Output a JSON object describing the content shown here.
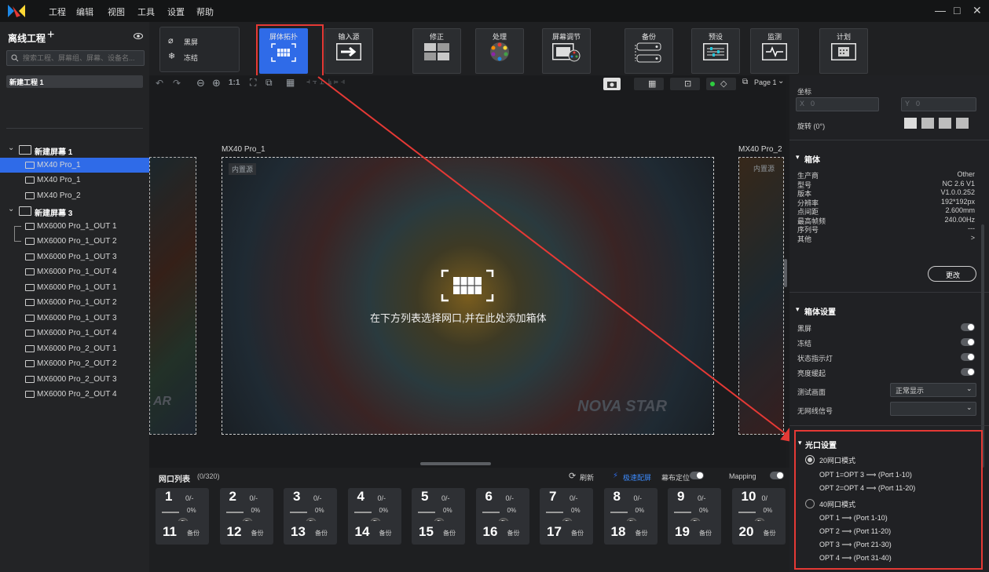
{
  "menu": {
    "items": [
      "工程",
      "编辑",
      "视图",
      "工具",
      "设置",
      "帮助"
    ]
  },
  "window_controls": {
    "minimize": "—",
    "maximize": "□",
    "close": "✕"
  },
  "project": {
    "title": "离线工程",
    "add": "+",
    "search_placeholder": "搜索工程、屏幕组、屏幕、设备名...",
    "current": "新建工程 1"
  },
  "toolbar": {
    "blackout": "黑屏",
    "freeze": "冻结",
    "buttons": [
      {
        "label": "屏体拓扑",
        "icon": "grid-icon"
      },
      {
        "label": "输入源",
        "icon": "arrow-right-icon"
      },
      {
        "label": "修正",
        "icon": "correction-icon"
      },
      {
        "label": "处理",
        "icon": "color-wheel-icon"
      },
      {
        "label": "屏幕调节",
        "icon": "screen-adjust-icon"
      },
      {
        "label": "备份",
        "icon": "backup-icon"
      },
      {
        "label": "预设",
        "icon": "preset-icon"
      },
      {
        "label": "监测",
        "icon": "monitor-icon"
      },
      {
        "label": "计划",
        "icon": "schedule-icon"
      }
    ]
  },
  "tree": {
    "screen1": "新建屏幕 1",
    "screen1_items": [
      "MX40 Pro_1",
      "MX40 Pro_1",
      "MX40 Pro_2"
    ],
    "screen3": "新建屏幕 3",
    "screen3_items": [
      "MX6000 Pro_1_OUT 1",
      "MX6000 Pro_1_OUT 2",
      "MX6000 Pro_1_OUT 3",
      "MX6000 Pro_1_OUT 4",
      "MX6000 Pro_1_OUT 1",
      "MX6000 Pro_1_OUT 2",
      "MX6000 Pro_1_OUT 3",
      "MX6000 Pro_1_OUT 4",
      "MX6000 Pro_2_OUT 1",
      "MX6000 Pro_2_OUT 2",
      "MX6000 Pro_2_OUT 3",
      "MX6000 Pro_2_OUT 4"
    ]
  },
  "canvas": {
    "zoom_label": "1:1",
    "page": "Page 1",
    "screen_left": "MX40 Pro_1",
    "screen_right": "MX40 Pro_2",
    "source_tag": "内置源",
    "hint": "在下方列表选择网口,并在此处添加箱体",
    "watermark": "NOVA STAR"
  },
  "portlist": {
    "title": "网口列表",
    "count": "(0/320)",
    "refresh": "刷新",
    "fast": "极速配屏",
    "locate": "幕布定位",
    "mapping": "Mapping",
    "ports": [
      {
        "n": "1",
        "frac": "0/-",
        "pct": "0%"
      },
      {
        "n": "2",
        "frac": "0/-",
        "pct": "0%"
      },
      {
        "n": "3",
        "frac": "0/-",
        "pct": "0%"
      },
      {
        "n": "4",
        "frac": "0/-",
        "pct": "0%"
      },
      {
        "n": "5",
        "frac": "0/-",
        "pct": "0%"
      },
      {
        "n": "6",
        "frac": "0/-",
        "pct": "0%"
      },
      {
        "n": "7",
        "frac": "0/-",
        "pct": "0%"
      },
      {
        "n": "8",
        "frac": "0/-",
        "pct": "0%"
      },
      {
        "n": "9",
        "frac": "0/-",
        "pct": "0%"
      },
      {
        "n": "10",
        "frac": "0/",
        "pct": "0%"
      }
    ],
    "backup_ports": [
      "11",
      "12",
      "13",
      "14",
      "15",
      "16",
      "17",
      "18",
      "19",
      "20"
    ],
    "backup_label": "备份"
  },
  "right": {
    "coord_label": "坐标",
    "x_label": "X",
    "x_value": "0",
    "y_label": "Y",
    "y_value": "0",
    "rotate_label": "旋转 (0°)",
    "cabinet_title": "箱体",
    "cabinet_rows": [
      {
        "k": "生产商",
        "v": "Other"
      },
      {
        "k": "型号",
        "v": "NC 2.6 V1"
      },
      {
        "k": "版本",
        "v": "V1.0.0.252"
      },
      {
        "k": "分辨率",
        "v": "192*192px"
      },
      {
        "k": "点间距",
        "v": "2.600mm"
      },
      {
        "k": "最高帧频",
        "v": "240.00Hz"
      },
      {
        "k": "序列号",
        "v": "---"
      },
      {
        "k": "其他",
        "v": ">"
      }
    ],
    "change_btn": "更改",
    "cab_settings_title": "箱体设置",
    "cab_settings": [
      "黑屏",
      "冻结",
      "状态指示灯",
      "亮度缓起"
    ],
    "test_label": "测试画面",
    "test_value": "正常显示",
    "nosignal_label": "无网线信号",
    "optical_title": "光口设置",
    "mode20": "20网口模式",
    "mode20_lines": [
      "OPT 1=OPT 3 ⟹ (Port 1-10)",
      "OPT 2=OPT 4 ⟹ (Port 11-20)"
    ],
    "mode40": "40网口模式",
    "mode40_lines": [
      "OPT 1 ⟹ (Port 1-10)",
      "OPT 2 ⟹ (Port 11-20)",
      "OPT 3 ⟹ (Port 21-30)",
      "OPT 4 ⟹ (Port 31-40)"
    ]
  },
  "colors": {
    "accent": "#2f6be8",
    "highlight": "#e53935",
    "bg": "#1b1c1e"
  }
}
